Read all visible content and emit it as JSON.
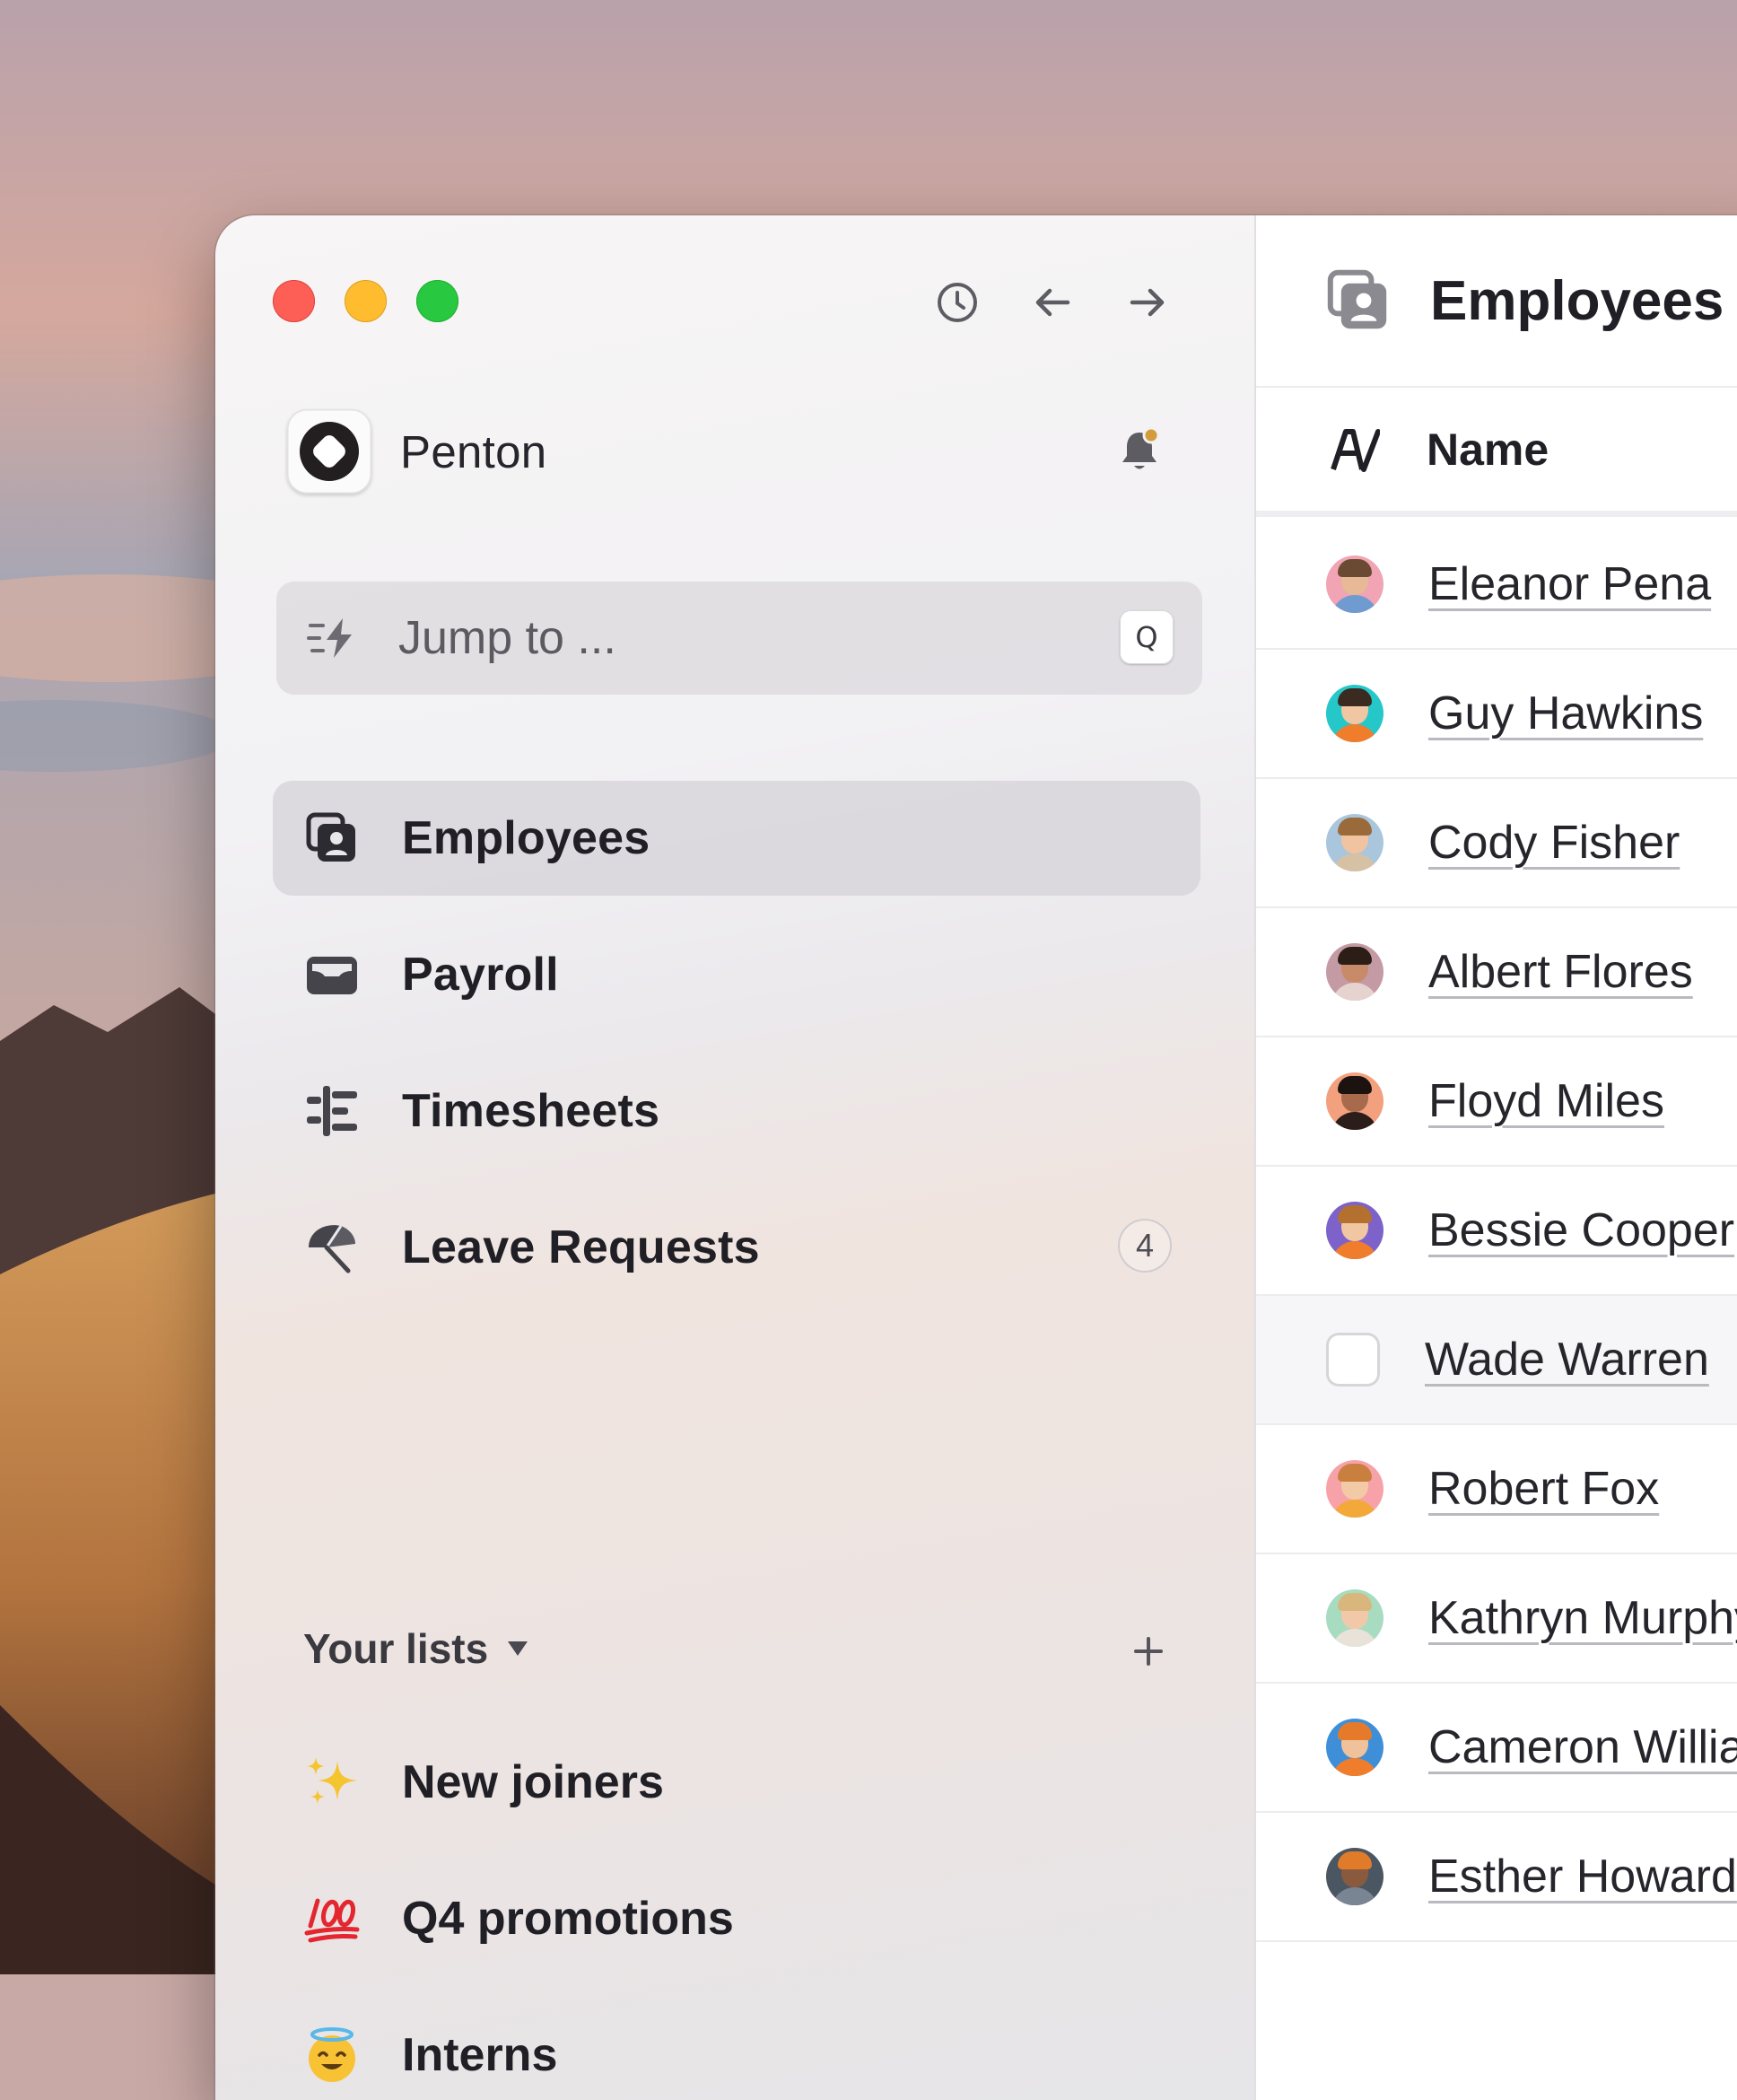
{
  "colors": {
    "accent_notification": "#d49b3a",
    "traffic_red": "#fd5f57",
    "traffic_yellow": "#febc2e",
    "traffic_green": "#28c840"
  },
  "window": {
    "toolbar_icons": [
      "history-icon",
      "back-arrow-icon",
      "forward-arrow-icon"
    ]
  },
  "workspace": {
    "name": "Penton",
    "notification_icon": "bell-icon"
  },
  "search": {
    "placeholder": "Jump to ...",
    "shortcut": "Q",
    "icon": "lightning-icon"
  },
  "nav": {
    "items": [
      {
        "label": "Employees",
        "icon": "employees-icon",
        "active": true
      },
      {
        "label": "Payroll",
        "icon": "wallet-icon"
      },
      {
        "label": "Timesheets",
        "icon": "timesheets-icon"
      },
      {
        "label": "Leave Requests",
        "icon": "umbrella-icon",
        "badge": "4"
      }
    ]
  },
  "lists": {
    "header": "Your lists",
    "add_icon": "plus-icon",
    "items": [
      {
        "label": "New joiners",
        "emoji": "✨"
      },
      {
        "label": "Q4 promotions",
        "emoji": "💯"
      },
      {
        "label": "Interns",
        "emoji": "😇"
      }
    ]
  },
  "main": {
    "title": "Employees",
    "column_header": "Name",
    "column_icon": "text-column-icon",
    "rows": [
      {
        "name": "Eleanor Pena"
      },
      {
        "name": "Guy Hawkins"
      },
      {
        "name": "Cody Fisher"
      },
      {
        "name": "Albert Flores"
      },
      {
        "name": "Floyd Miles"
      },
      {
        "name": "Bessie Cooper"
      },
      {
        "name": "Wade Warren",
        "hovered": true
      },
      {
        "name": "Robert Fox"
      },
      {
        "name": "Kathryn Murphy"
      },
      {
        "name": "Cameron Williamson"
      },
      {
        "name": "Esther Howard"
      }
    ]
  }
}
